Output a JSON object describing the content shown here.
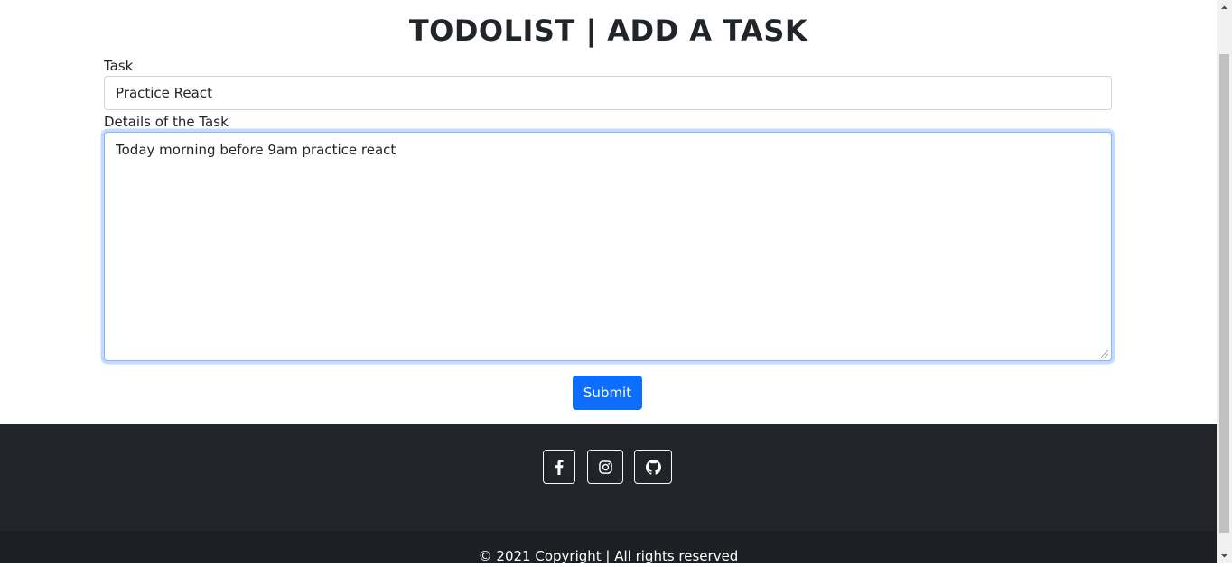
{
  "page": {
    "title": "TODOLIST | ADD A TASK"
  },
  "form": {
    "task_label": "Task",
    "task_value": "Practice React",
    "details_label": "Details of the Task",
    "details_value": "Today morning before 9am practice react",
    "submit_label": "Submit"
  },
  "footer": {
    "social": [
      {
        "icon": "facebook-icon"
      },
      {
        "icon": "instagram-icon"
      },
      {
        "icon": "github-icon"
      }
    ],
    "copyright": "© 2021 Copyright | All rights reserved"
  },
  "colors": {
    "primary": "#0d6efd",
    "footer_bg": "#212529",
    "footer_bottom_bg": "#1c1f23",
    "focus_border": "#86b7fe"
  }
}
